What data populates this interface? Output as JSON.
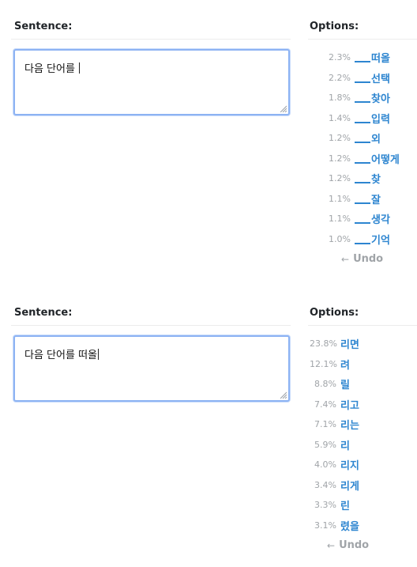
{
  "panels": [
    {
      "sentence_label": "Sentence:",
      "options_label": "Options:",
      "textarea_value": "다음 단어를 ",
      "options": [
        {
          "pct": "2.3%",
          "word": "떠올"
        },
        {
          "pct": "2.2%",
          "word": "선택"
        },
        {
          "pct": "1.8%",
          "word": "찾아"
        },
        {
          "pct": "1.4%",
          "word": "입력"
        },
        {
          "pct": "1.2%",
          "word": "외"
        },
        {
          "pct": "1.2%",
          "word": "어떻게"
        },
        {
          "pct": "1.2%",
          "word": "찾"
        },
        {
          "pct": "1.1%",
          "word": "잘"
        },
        {
          "pct": "1.1%",
          "word": "생각"
        },
        {
          "pct": "1.0%",
          "word": "기억"
        }
      ],
      "undo_label": "Undo",
      "undo_arrow": "←"
    },
    {
      "sentence_label": "Sentence:",
      "options_label": "Options:",
      "textarea_value": "다음 단어를 떠올",
      "options": [
        {
          "pct": "23.8%",
          "word": "리면"
        },
        {
          "pct": "12.1%",
          "word": "려"
        },
        {
          "pct": "8.8%",
          "word": "릴"
        },
        {
          "pct": "7.4%",
          "word": "리고"
        },
        {
          "pct": "7.1%",
          "word": "리는"
        },
        {
          "pct": "5.9%",
          "word": "리"
        },
        {
          "pct": "4.0%",
          "word": "리지"
        },
        {
          "pct": "3.4%",
          "word": "리게"
        },
        {
          "pct": "3.3%",
          "word": "린"
        },
        {
          "pct": "3.1%",
          "word": "렸을"
        }
      ],
      "undo_label": "Undo",
      "undo_arrow": "←"
    }
  ],
  "colors": {
    "option_word": "#2d85d0",
    "percent": "#a0a4a8",
    "focus_border": "#8db3f3"
  }
}
